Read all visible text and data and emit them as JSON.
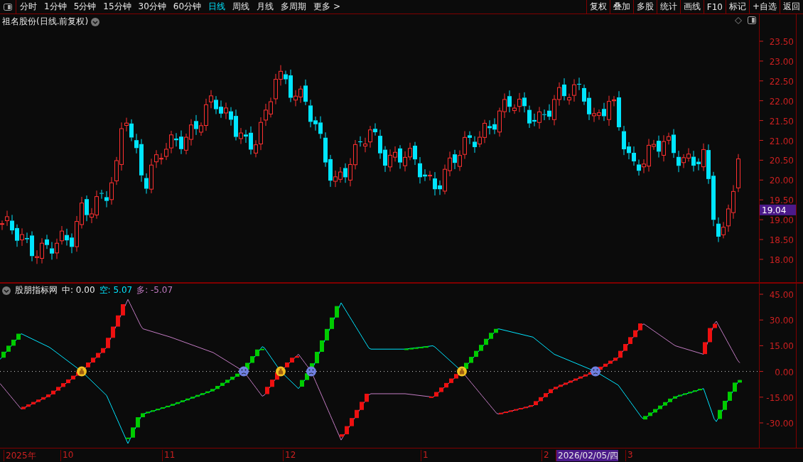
{
  "toolbar": {
    "tabs": [
      {
        "label": "分时",
        "selected": false
      },
      {
        "label": "1分钟",
        "selected": false
      },
      {
        "label": "5分钟",
        "selected": false
      },
      {
        "label": "15分钟",
        "selected": false
      },
      {
        "label": "30分钟",
        "selected": false
      },
      {
        "label": "60分钟",
        "selected": false
      },
      {
        "label": "日线",
        "selected": true
      },
      {
        "label": "周线",
        "selected": false
      },
      {
        "label": "月线",
        "selected": false
      },
      {
        "label": "多周期",
        "selected": false
      },
      {
        "label": "更多 >",
        "selected": false
      }
    ],
    "buttons": [
      "复权",
      "叠加",
      "多股",
      "统计",
      "画线",
      "F10",
      "标记",
      "+自选",
      "返回"
    ]
  },
  "main_chart": {
    "title": "祖名股份(日线.前复权)",
    "price_axis": [
      "23.50",
      "23.00",
      "22.50",
      "22.00",
      "21.50",
      "21.00",
      "20.50",
      "20.00",
      "19.50",
      "19.00",
      "18.50",
      "18.00"
    ],
    "last_price": "19.04"
  },
  "indicator": {
    "name": "股朋指标网",
    "readings": [
      {
        "text": "中: 0.00",
        "color": "#e8e8e8"
      },
      {
        "text": "空: 5.07",
        "color": "#00e5ff"
      },
      {
        "text": "多: -5.07",
        "color": "#c27bc2"
      }
    ],
    "axis": [
      "45.00",
      "30.00",
      "15.00",
      "0.00",
      "-15.00",
      "-30.00"
    ]
  },
  "date_axis": [
    {
      "label": "2025年",
      "selected": false
    },
    {
      "label": "10",
      "selected": false
    },
    {
      "label": "11",
      "selected": false
    },
    {
      "label": "12",
      "selected": false
    },
    {
      "label": "1",
      "selected": false
    },
    {
      "label": "2",
      "selected": false
    },
    {
      "label": "2026/02/05/四",
      "selected": true
    },
    {
      "label": "3",
      "selected": false
    }
  ]
}
